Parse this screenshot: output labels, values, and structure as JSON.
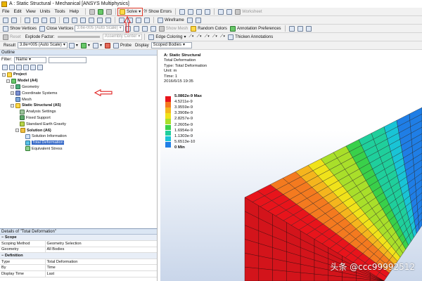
{
  "window": {
    "title": "A : Static Structural - Mechanical [ANSYS Multiphysics]"
  },
  "menu": [
    "File",
    "Edit",
    "View",
    "Units",
    "Tools",
    "Help"
  ],
  "toolbar_main": {
    "solve": "Solve",
    "show_errors": "Show Errors",
    "worksheet": "Worksheet"
  },
  "toolbar_view": {
    "show_vertices": "Show Vertices",
    "close_vertices": "Close Vertices",
    "auto_scale": "3.6e-005 (Auto Scale)",
    "show_mesh": "Show Mesh",
    "random_colors": "Random Colors",
    "annotation_preferences": "Annotation Preferences"
  },
  "toolbar_explode": {
    "reset": "Reset",
    "explode_factor": "Explode Factor:",
    "assembly_center": "Assembly Center",
    "edge_coloring": "Edge Coloring",
    "thicken_annotations": "Thicken Annotations"
  },
  "toolbar_result": {
    "result": "Result",
    "scale": "3.8e+005 (Auto Scale)",
    "probe": "Probe",
    "display": "Display",
    "scoped_bodies": "Scoped Bodies"
  },
  "toolbar_graphics": {
    "wireframe": "Wireframe"
  },
  "outline": {
    "header": "Outline",
    "filter_label": "Filter:",
    "filter_value": "Name",
    "tree": [
      {
        "label": "Project",
        "level": 0,
        "icon": "project-icon",
        "bold": true
      },
      {
        "label": "Model (A4)",
        "level": 1,
        "icon": "model-icon",
        "bold": true
      },
      {
        "label": "Geometry",
        "level": 2,
        "icon": "geometry-icon"
      },
      {
        "label": "Coordinate Systems",
        "level": 2,
        "icon": "coordinate-systems-icon"
      },
      {
        "label": "Mesh",
        "level": 2,
        "icon": "mesh-icon"
      },
      {
        "label": "Static Structural (A5)",
        "level": 2,
        "icon": "static-structural-icon",
        "bold": true
      },
      {
        "label": "Analysis Settings",
        "level": 3,
        "icon": "analysis-settings-icon"
      },
      {
        "label": "Fixed Support",
        "level": 3,
        "icon": "fixed-support-icon"
      },
      {
        "label": "Standard Earth Gravity",
        "level": 3,
        "icon": "gravity-icon"
      },
      {
        "label": "Solution (A6)",
        "level": 3,
        "icon": "solution-icon",
        "bold": true
      },
      {
        "label": "Solution Information",
        "level": 4,
        "icon": "solution-information-icon"
      },
      {
        "label": "Total Deformation",
        "level": 4,
        "icon": "total-deformation-icon",
        "selected": true
      },
      {
        "label": "Equivalent Stress",
        "level": 4,
        "icon": "equivalent-stress-icon"
      }
    ]
  },
  "details": {
    "header": "Details of \"Total Deformation\"",
    "rows": [
      {
        "group": true,
        "key": "Scope"
      },
      {
        "key": "Scoping Method",
        "value": "Geometry Selection"
      },
      {
        "key": "Geometry",
        "value": "All Bodies"
      },
      {
        "group": true,
        "key": "Definition"
      },
      {
        "key": "Type",
        "value": "Total Deformation"
      },
      {
        "key": "By",
        "value": "Time"
      },
      {
        "key": "Display Time",
        "value": "Last"
      }
    ]
  },
  "viewport": {
    "info": {
      "title": "A: Static Structural",
      "result": "Total Deformation",
      "type": "Type: Total Deformation",
      "unit": "Unit: m",
      "time": "Time: 1",
      "date": "2016/6/15 19:35"
    },
    "legend": [
      {
        "label": "5.0862e-9 Max",
        "color": "#e8141b",
        "bold": true
      },
      {
        "label": "4.5211e-9",
        "color": "#f47a1f"
      },
      {
        "label": "3.9559e-9",
        "color": "#f5b51d"
      },
      {
        "label": "3.3908e-9",
        "color": "#f0e21a"
      },
      {
        "label": "2.8257e-9",
        "color": "#a9df2a"
      },
      {
        "label": "2.2605e-9",
        "color": "#39d04a"
      },
      {
        "label": "1.6954e-9",
        "color": "#1fcf9c"
      },
      {
        "label": "1.1303e-9",
        "color": "#19c4d6"
      },
      {
        "label": "5.6513e-10",
        "color": "#1f7ee6"
      },
      {
        "label": "0 Min",
        "color": "#1a2de0",
        "bold": true
      }
    ],
    "watermark": "头条 @ccc99992512"
  }
}
